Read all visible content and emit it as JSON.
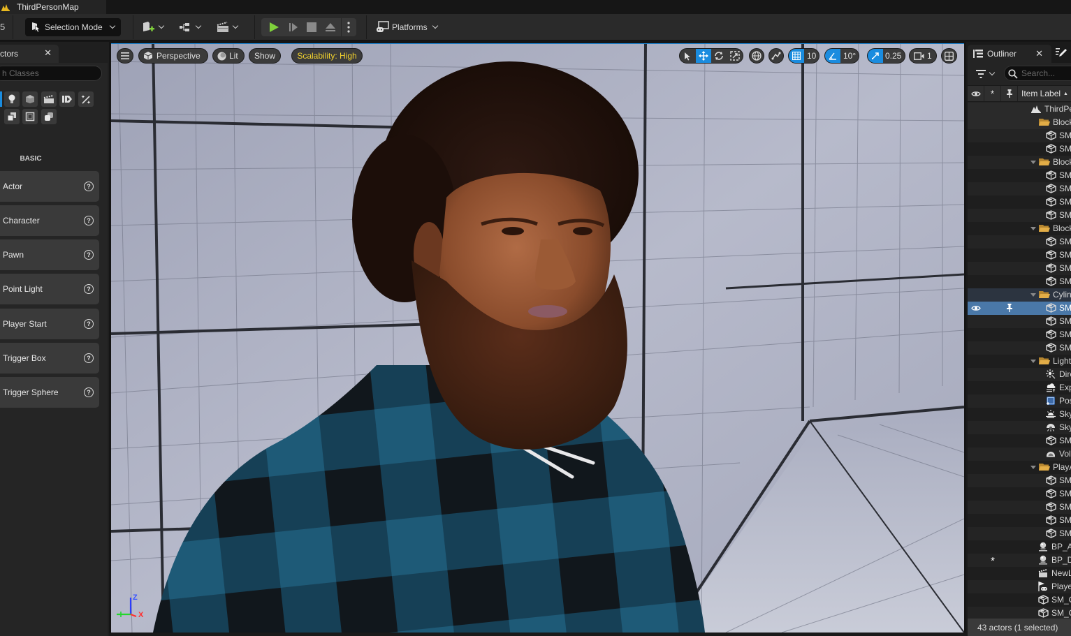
{
  "window": {
    "level_tab": "ThirdPersonMap",
    "left_edge_char": "5"
  },
  "toolbar": {
    "selection_mode": "Selection Mode",
    "platforms": "Platforms",
    "play_color": "#7fd13b"
  },
  "place_actors": {
    "tab_label": "ctors",
    "search_placeholder": "h Classes",
    "category": "BASIC",
    "category_icons": [
      "recently-placed-icon",
      "light-bulb-icon",
      "shapes-cube-icon",
      "cinematic-clapper-icon",
      "visual-effects-icon",
      "magic-wand-icon",
      "all-classes-icon",
      "volumes-icon",
      "geometry-icon"
    ],
    "items": [
      {
        "label": "Actor"
      },
      {
        "label": "Character"
      },
      {
        "label": "Pawn"
      },
      {
        "label": "Point Light"
      },
      {
        "label": "Player Start"
      },
      {
        "label": "Trigger Box"
      },
      {
        "label": "Trigger Sphere"
      }
    ]
  },
  "viewport": {
    "perspective": "Perspective",
    "lit": "Lit",
    "show": "Show",
    "scalability": "Scalability: High",
    "scalability_color": "#f2d22e",
    "grid_snap": "10",
    "rotation_snap": "10°",
    "scale_snap": "0.25",
    "camera_speed": "1",
    "accent": "#1a8cdf",
    "gizmo": {
      "z": "Z",
      "x": "X"
    }
  },
  "outliner": {
    "tab_label": "Outliner",
    "search_placeholder": "Search...",
    "column_label": "Item Label",
    "status": "43 actors (1 selected)",
    "rows": [
      {
        "label": "ThirdPersonMap",
        "type": "level",
        "indent": 0
      },
      {
        "label": "Blockout",
        "type": "folder",
        "indent": 1,
        "expanded": false
      },
      {
        "label": "SM_Cube",
        "type": "mesh",
        "indent": 2
      },
      {
        "label": "SM_Cube",
        "type": "mesh",
        "indent": 2
      },
      {
        "label": "Blockout",
        "type": "folder",
        "indent": 1,
        "expanded": true
      },
      {
        "label": "SM_Cube",
        "type": "mesh",
        "indent": 2
      },
      {
        "label": "SM_Cube",
        "type": "mesh",
        "indent": 2
      },
      {
        "label": "SM_Cube",
        "type": "mesh",
        "indent": 2
      },
      {
        "label": "SM_Cube",
        "type": "mesh",
        "indent": 2
      },
      {
        "label": "Blockout",
        "type": "folder",
        "indent": 1,
        "expanded": true
      },
      {
        "label": "SM_Cube",
        "type": "mesh",
        "indent": 2
      },
      {
        "label": "SM_Cube",
        "type": "mesh",
        "indent": 2
      },
      {
        "label": "SM_Cube",
        "type": "mesh",
        "indent": 2
      },
      {
        "label": "SM_Cube",
        "type": "mesh",
        "indent": 2
      },
      {
        "label": "Cylinders",
        "type": "folder",
        "indent": 1,
        "expanded": true
      },
      {
        "label": "SM_Cylinder",
        "type": "mesh",
        "indent": 2,
        "selected": true
      },
      {
        "label": "SM_Cylinder",
        "type": "mesh",
        "indent": 2
      },
      {
        "label": "SM_Cylinder",
        "type": "mesh",
        "indent": 2
      },
      {
        "label": "SM_Cylinder",
        "type": "mesh",
        "indent": 2
      },
      {
        "label": "Lighting",
        "type": "folder",
        "indent": 1,
        "expanded": true
      },
      {
        "label": "DirectionalLight",
        "type": "dirlight",
        "indent": 2
      },
      {
        "label": "ExponentialHeightFog",
        "type": "fog",
        "indent": 2
      },
      {
        "label": "PostProcessVolume",
        "type": "ppv",
        "indent": 2
      },
      {
        "label": "SkyAtmosphere",
        "type": "skyatmo",
        "indent": 2
      },
      {
        "label": "SkyLight",
        "type": "skylight",
        "indent": 2
      },
      {
        "label": "SM_SkySphere",
        "type": "mesh",
        "indent": 2
      },
      {
        "label": "VolumetricCloud",
        "type": "cloud",
        "indent": 2
      },
      {
        "label": "PlayArea",
        "type": "folder",
        "indent": 1,
        "expanded": true
      },
      {
        "label": "SM_Cube",
        "type": "mesh",
        "indent": 2
      },
      {
        "label": "SM_Cube",
        "type": "mesh",
        "indent": 2
      },
      {
        "label": "SM_Cube",
        "type": "mesh",
        "indent": 2
      },
      {
        "label": "SM_Cube",
        "type": "mesh",
        "indent": 2
      },
      {
        "label": "SM_Cube",
        "type": "mesh",
        "indent": 2
      },
      {
        "label": "BP_A",
        "type": "pawn",
        "indent": 1
      },
      {
        "label": "BP_D",
        "type": "pawn",
        "indent": 1,
        "starred": true
      },
      {
        "label": "NewLevelSequence",
        "type": "sequence",
        "indent": 1
      },
      {
        "label": "PlayerStart",
        "type": "playerstart",
        "indent": 1
      },
      {
        "label": "SM_Cube",
        "type": "mesh",
        "indent": 1
      },
      {
        "label": "SM_Cube",
        "type": "mesh",
        "indent": 1
      }
    ]
  }
}
